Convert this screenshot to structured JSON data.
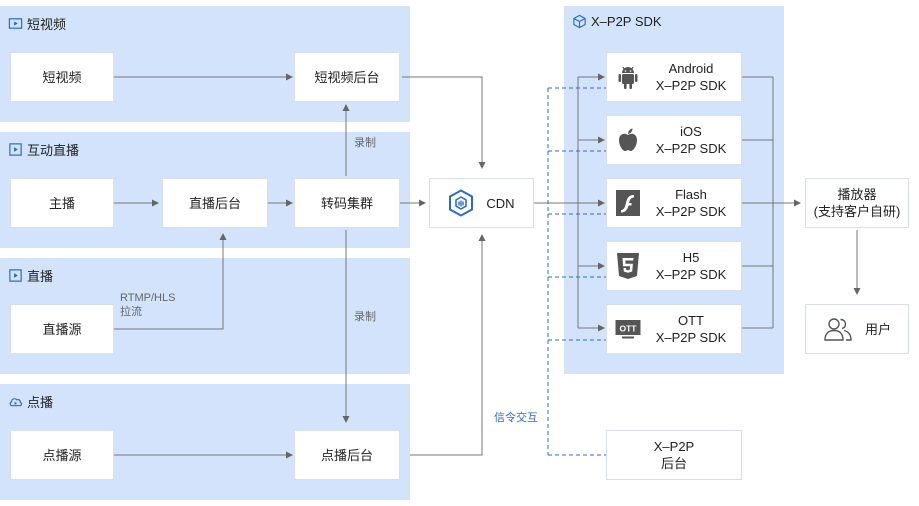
{
  "panels": {
    "short_video": "短视频",
    "interactive_live": "互动直播",
    "live": "直播",
    "vod": "点播",
    "sdk_group": "X–P2P SDK"
  },
  "nodes": {
    "short_video": "短视频",
    "short_video_backend": "短视频后台",
    "anchor": "主播",
    "live_backend": "直播后台",
    "transcode_cluster": "转码集群",
    "live_source": "直播源",
    "vod_source": "点播源",
    "vod_backend": "点播后台",
    "cdn": "CDN",
    "player_line1": "播放器",
    "player_line2": "(支持客户自研)",
    "user": "用户",
    "xp2p_backend_line1": "X–P2P",
    "xp2p_backend_line2": "后台"
  },
  "sdks": [
    {
      "name": "Android",
      "sub": "X–P2P SDK",
      "icon": "android-icon"
    },
    {
      "name": "iOS",
      "sub": "X–P2P SDK",
      "icon": "apple-icon"
    },
    {
      "name": "Flash",
      "sub": "X–P2P SDK",
      "icon": "flash-icon"
    },
    {
      "name": "H5",
      "sub": "X–P2P SDK",
      "icon": "html5-icon"
    },
    {
      "name": "OTT",
      "sub": "X–P2P SDK",
      "icon": "ott-icon"
    }
  ],
  "labels": {
    "record_top": "录制",
    "record_mid": "录制",
    "rtmp_line1": "RTMP/HLS",
    "rtmp_line2": "拉流",
    "signal": "信令交互"
  },
  "icon_labels": {
    "ott_badge": "OTT"
  },
  "colors": {
    "panel_bg": "#d2e3fb",
    "arrow": "#666666",
    "signal_dash": "#2b6cc4",
    "cdn_icon": "#2b6cc4"
  }
}
